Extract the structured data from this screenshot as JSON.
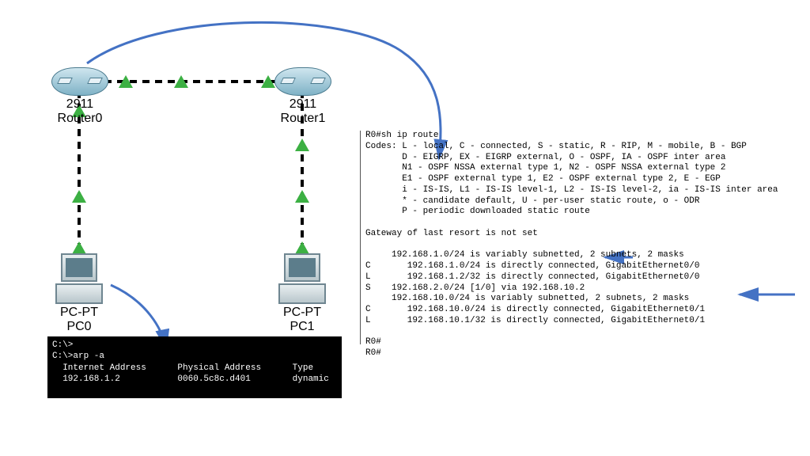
{
  "devices": {
    "router0": {
      "model": "2911",
      "name": "Router0"
    },
    "router1": {
      "model": "2911",
      "name": "Router1"
    },
    "pc0": {
      "type": "PC-PT",
      "name": "PC0"
    },
    "pc1": {
      "type": "PC-PT",
      "name": "PC1"
    }
  },
  "arp_terminal": {
    "prompt1": "C:\\>",
    "cmd": "C:\\>arp -a",
    "header": "  Internet Address      Physical Address      Type",
    "row": "  192.168.1.2           0060.5c8c.d401        dynamic"
  },
  "route_cli": {
    "line0": "R0#sh ip route",
    "codes0": "Codes: L - local, C - connected, S - static, R - RIP, M - mobile, B - BGP",
    "codes1": "       D - EIGRP, EX - EIGRP external, O - OSPF, IA - OSPF inter area",
    "codes2": "       N1 - OSPF NSSA external type 1, N2 - OSPF NSSA external type 2",
    "codes3": "       E1 - OSPF external type 1, E2 - OSPF external type 2, E - EGP",
    "codes4": "       i - IS-IS, L1 - IS-IS level-1, L2 - IS-IS level-2, ia - IS-IS inter area",
    "codes5": "       * - candidate default, U - per-user static route, o - ODR",
    "codes6": "       P - periodic downloaded static route",
    "blank": "",
    "gw": "Gateway of last resort is not set",
    "r0": "     192.168.1.0/24 is variably subnetted, 2 subnets, 2 masks",
    "r1": "C       192.168.1.0/24 is directly connected, GigabitEthernet0/0",
    "r2": "L       192.168.1.2/32 is directly connected, GigabitEthernet0/0",
    "r3": "S    192.168.2.0/24 [1/0] via 192.168.10.2",
    "r4": "     192.168.10.0/24 is variably subnetted, 2 subnets, 2 masks",
    "r5": "C       192.168.10.0/24 is directly connected, GigabitEthernet0/1",
    "r6": "L       192.168.10.1/32 is directly connected, GigabitEthernet0/1",
    "end0": "R0#",
    "end1": "R0#"
  },
  "colors": {
    "arrow": "#4472c4",
    "triangle": "#3cb043"
  }
}
